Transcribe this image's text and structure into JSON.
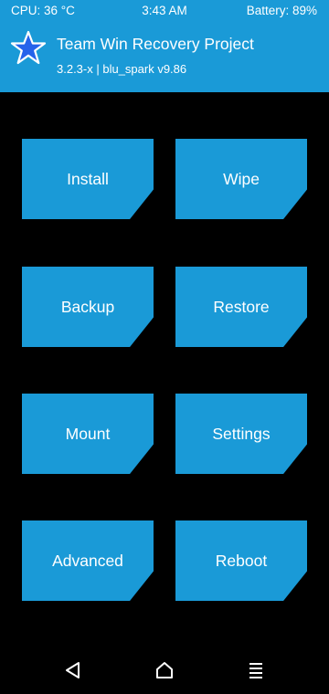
{
  "status": {
    "cpu": "CPU: 36 °C",
    "time": "3:43 AM",
    "battery": "Battery: 89%"
  },
  "header": {
    "title": "Team Win Recovery Project",
    "subtitle": "3.2.3-x | blu_spark v9.86",
    "logo_icon": "star-icon",
    "background": "#1a9ad7"
  },
  "buttons": {
    "install": "Install",
    "wipe": "Wipe",
    "backup": "Backup",
    "restore": "Restore",
    "mount": "Mount",
    "settings": "Settings",
    "advanced": "Advanced",
    "reboot": "Reboot"
  },
  "navbar": {
    "back_icon": "back-triangle-icon",
    "home_icon": "home-icon",
    "menu_icon": "menu-lines-icon"
  },
  "colors": {
    "accent": "#1a9ad7",
    "background": "#000000",
    "text": "#ffffff"
  }
}
